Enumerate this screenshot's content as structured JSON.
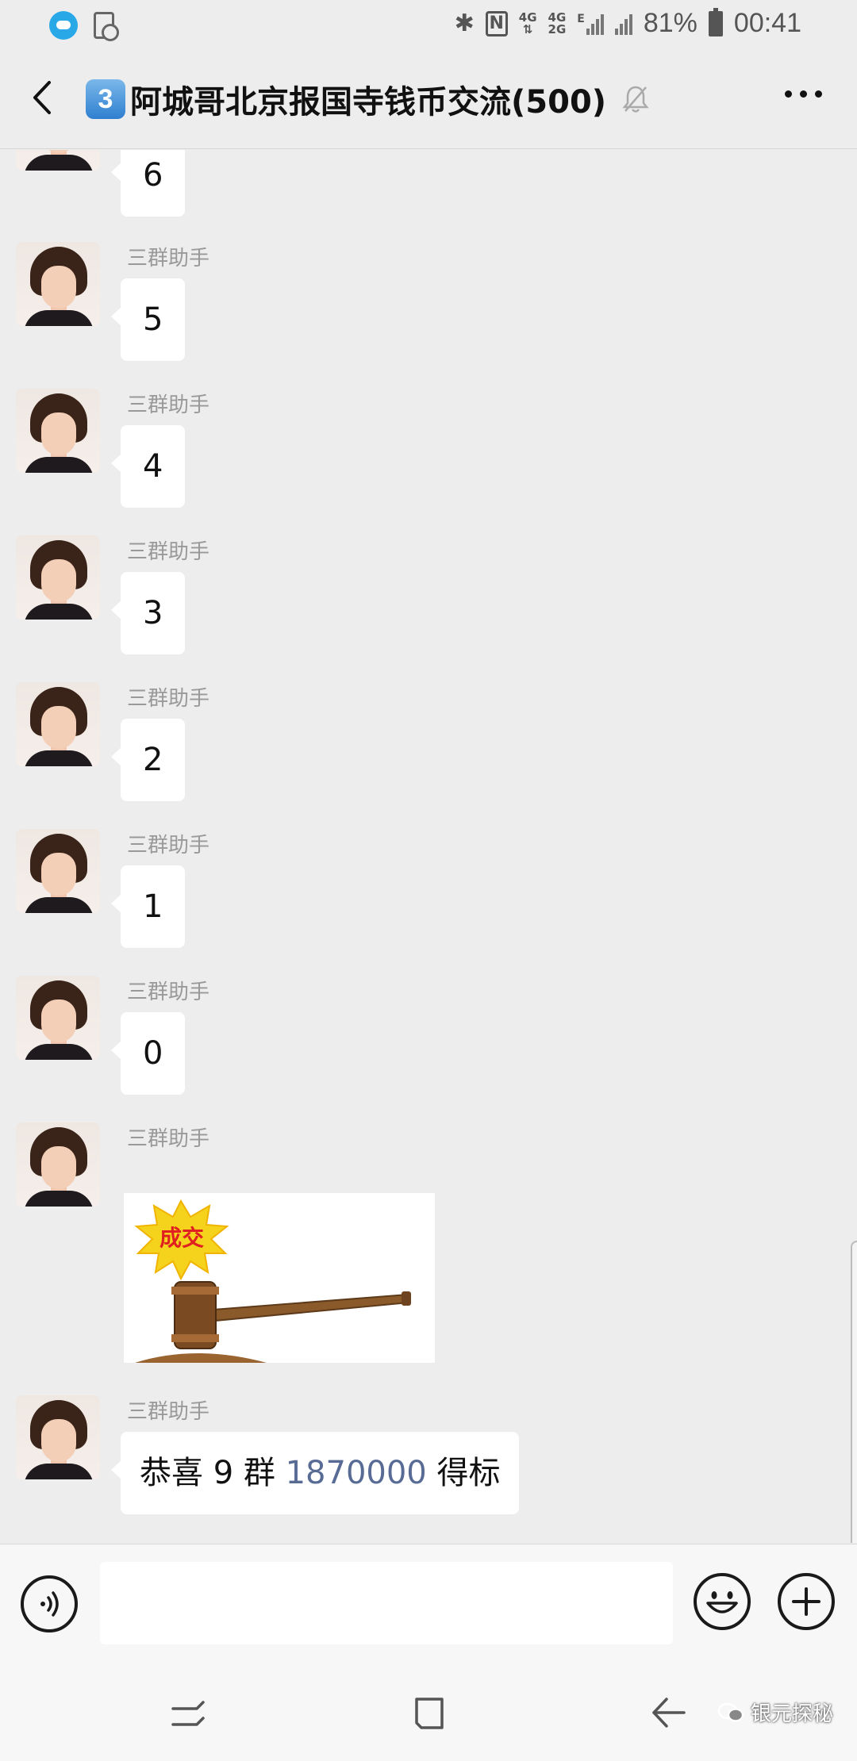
{
  "status_bar": {
    "network_top": "4G",
    "network_2": "4G",
    "network_2b": "2G",
    "network_e": "E",
    "battery": "81%",
    "time": "00:41"
  },
  "header": {
    "badge": "3",
    "title": "阿城哥北京报国寺钱币交流(500)"
  },
  "messages": [
    {
      "sender": "",
      "text": "6"
    },
    {
      "sender": "三群助手",
      "text": "5"
    },
    {
      "sender": "三群助手",
      "text": "4"
    },
    {
      "sender": "三群助手",
      "text": "3"
    },
    {
      "sender": "三群助手",
      "text": "2"
    },
    {
      "sender": "三群助手",
      "text": "1"
    },
    {
      "sender": "三群助手",
      "text": "0"
    },
    {
      "sender": "三群助手",
      "image_text": "成交",
      "image_icon": "auction-gavel-icon"
    },
    {
      "sender": "三群助手",
      "text_prefix": "恭喜 9 群 ",
      "text_highlight": "1870000",
      "text_suffix": " 得标"
    }
  ],
  "input_bar": {
    "placeholder": ""
  },
  "watermark": {
    "text": "银元探秘"
  },
  "colors": {
    "background": "#ededed",
    "bubble": "#ffffff",
    "link_blue": "#576b95",
    "sender_gray": "#999999"
  }
}
